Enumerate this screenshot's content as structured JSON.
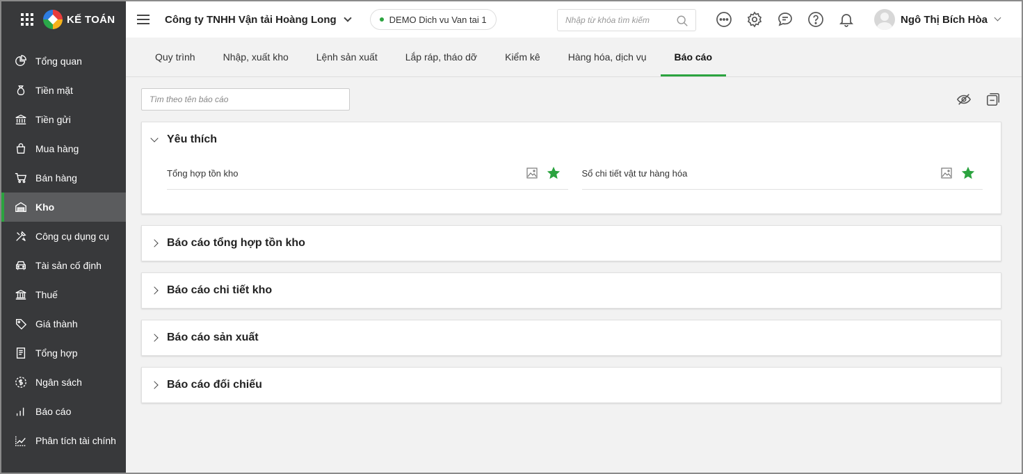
{
  "brand": {
    "name": "KẾ TOÁN"
  },
  "sidebar": {
    "items": [
      {
        "label": "Tổng quan",
        "icon": "pie-chart-icon"
      },
      {
        "label": "Tiền mặt",
        "icon": "money-bag-icon"
      },
      {
        "label": "Tiền gửi",
        "icon": "bank-deposit-icon"
      },
      {
        "label": "Mua hàng",
        "icon": "shopping-bag-icon"
      },
      {
        "label": "Bán hàng",
        "icon": "cart-icon"
      },
      {
        "label": "Kho",
        "icon": "warehouse-icon",
        "active": true
      },
      {
        "label": "Công cụ dụng cụ",
        "icon": "tools-icon"
      },
      {
        "label": "Tài sản cố định",
        "icon": "car-icon"
      },
      {
        "label": "Thuế",
        "icon": "tax-building-icon"
      },
      {
        "label": "Giá thành",
        "icon": "price-tag-icon"
      },
      {
        "label": "Tổng hợp",
        "icon": "ledger-icon"
      },
      {
        "label": "Ngân sách",
        "icon": "budget-coin-icon"
      },
      {
        "label": "Báo cáo",
        "icon": "bar-chart-icon"
      },
      {
        "label": "Phân tích tài chính",
        "icon": "line-chart-icon"
      }
    ]
  },
  "header": {
    "company": "Công ty TNHH Vận tải Hoàng Long",
    "database": "DEMO Dich vu Van tai 1",
    "search_placeholder": "Nhập từ khóa tìm kiếm",
    "user_name": "Ngô Thị Bích Hòa"
  },
  "tabs": [
    {
      "label": "Quy trình"
    },
    {
      "label": "Nhập, xuất kho"
    },
    {
      "label": "Lệnh sản xuất"
    },
    {
      "label": "Lắp ráp, tháo dỡ"
    },
    {
      "label": "Kiểm kê"
    },
    {
      "label": "Hàng hóa, dịch vụ"
    },
    {
      "label": "Báo cáo",
      "active": true
    }
  ],
  "reports": {
    "search_placeholder": "Tìm theo tên báo cáo",
    "favorites": {
      "title": "Yêu thích",
      "items": [
        {
          "label": "Tổng hợp tồn kho"
        },
        {
          "label": "Sổ chi tiết vật tư hàng hóa"
        }
      ]
    },
    "groups": [
      {
        "title": "Báo cáo tổng hợp tồn kho"
      },
      {
        "title": "Báo cáo chi tiết kho"
      },
      {
        "title": "Báo cáo sản xuất"
      },
      {
        "title": "Báo cáo đối chiếu"
      }
    ]
  },
  "colors": {
    "accent": "#2ba33f",
    "sidebar_bg": "#38393b",
    "sidebar_active": "#5b5c5e"
  }
}
